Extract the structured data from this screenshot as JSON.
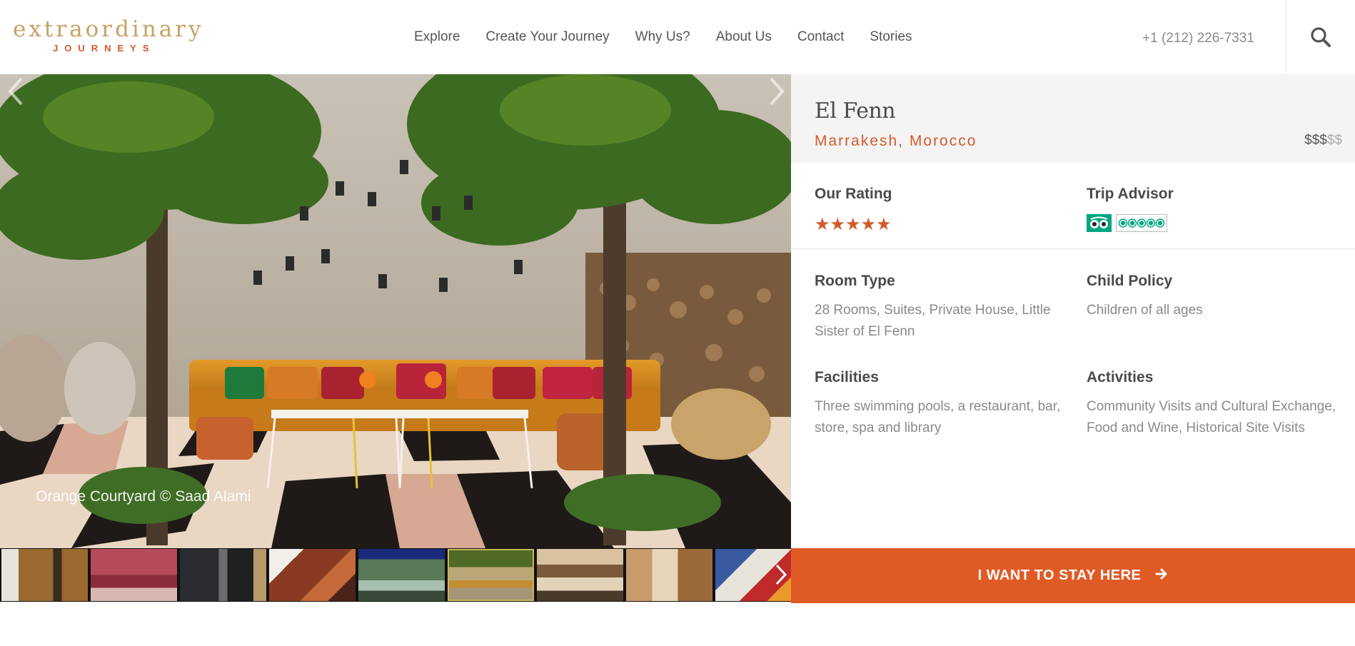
{
  "logo": {
    "line1": "extraordinary",
    "line2": "JOURNEYS"
  },
  "nav": {
    "items": [
      "Explore",
      "Create Your Journey",
      "Why Us?",
      "About Us",
      "Contact",
      "Stories"
    ]
  },
  "header": {
    "phone": "+1 (212) 226-7331",
    "search_icon": "search-icon"
  },
  "hero": {
    "caption": "Orange Courtyard © Saad Alami",
    "prev_icon": "chevron-left-icon",
    "next_icon": "chevron-right-icon"
  },
  "thumbnails": {
    "count": 9,
    "active_index": 5,
    "next_icon": "chevron-right-icon"
  },
  "hotel": {
    "name": "El Fenn",
    "city": "Marrakesh",
    "separator": ",",
    "country": "Morocco",
    "price_active": "$$$",
    "price_inactive": "$$"
  },
  "ratings": {
    "our_rating_label": "Our Rating",
    "our_rating_stars": "★★★★★",
    "our_rating_value": 5,
    "trip_advisor_label": "Trip Advisor",
    "trip_advisor_value": 5
  },
  "details": {
    "room_type_label": "Room Type",
    "room_type_value": "28 Rooms, Suites, Private House, Little Sister of El Fenn",
    "child_policy_label": "Child Policy",
    "child_policy_value": "Children of all ages",
    "facilities_label": "Facilities",
    "facilities_value": "Three swimming pools, a restaurant, bar, store, spa and library",
    "activities_label": "Activities",
    "activities_value": "Community Visits and Cultural Exchange, Food and Wine, Historical Site Visits"
  },
  "cta": {
    "label": "I WANT TO STAY HERE",
    "icon": "arrow-right-icon"
  },
  "colors": {
    "accent": "#e05a25",
    "gold": "#c8a165",
    "trip_advisor_green": "#00a680"
  }
}
